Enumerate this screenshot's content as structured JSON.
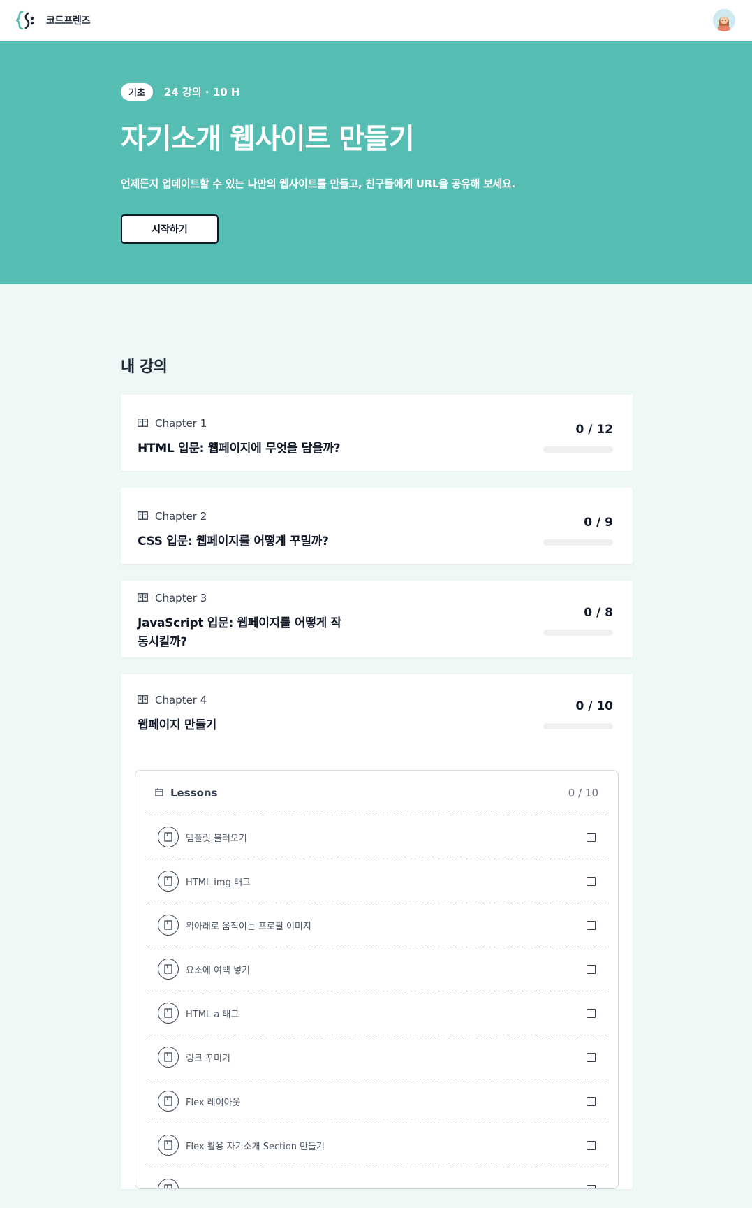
{
  "header": {
    "brand_name": "코드프렌즈",
    "logo_icon": "codefriends-logo-icon",
    "avatar_icon": "user-avatar-icon"
  },
  "hero": {
    "level": "기초",
    "meta": "24 강의 · 10 H",
    "title": "자기소개 웹사이트 만들기",
    "description": "언제든지 업데이트할 수 있는 나만의 웹사이트를 만들고, 친구들에게 URL을 공유해 보세요.",
    "start_label": "시작하기",
    "background_color": "#56bdb3"
  },
  "main": {
    "section_title": "내 강의",
    "chapters": [
      {
        "label": "Chapter 1",
        "title": "HTML 입문: 웹페이지에 무엇을 담을까?",
        "progress": "0 / 12",
        "completed": 0,
        "total": 12
      },
      {
        "label": "Chapter 2",
        "title": "CSS 입문: 웹페이지를 어떻게 꾸밀까?",
        "progress": "0 / 9",
        "completed": 0,
        "total": 9
      },
      {
        "label": "Chapter 3",
        "title": "JavaScript 입문: 웹페이지를 어떻게 작동시킬까?",
        "progress": "0 / 8",
        "completed": 0,
        "total": 8
      },
      {
        "label": "Chapter 4",
        "title": "웹페이지 만들기",
        "progress": "0 / 10",
        "completed": 0,
        "total": 10
      }
    ],
    "lessons_panel": {
      "title": "Lessons",
      "count": "0 / 10",
      "items": [
        {
          "name": "템플릿 불러오기",
          "checked": false
        },
        {
          "name": "HTML img 태그",
          "checked": false
        },
        {
          "name": "위아래로 움직이는 프로필 이미지",
          "checked": false
        },
        {
          "name": "요소에 여백 넣기",
          "checked": false
        },
        {
          "name": "HTML a 태그",
          "checked": false
        },
        {
          "name": "링크 꾸미기",
          "checked": false
        },
        {
          "name": "Flex 레이아웃",
          "checked": false
        },
        {
          "name": "Flex 활용 자기소개 Section 만들기",
          "checked": false
        },
        {
          "name": "",
          "checked": false
        }
      ]
    }
  }
}
